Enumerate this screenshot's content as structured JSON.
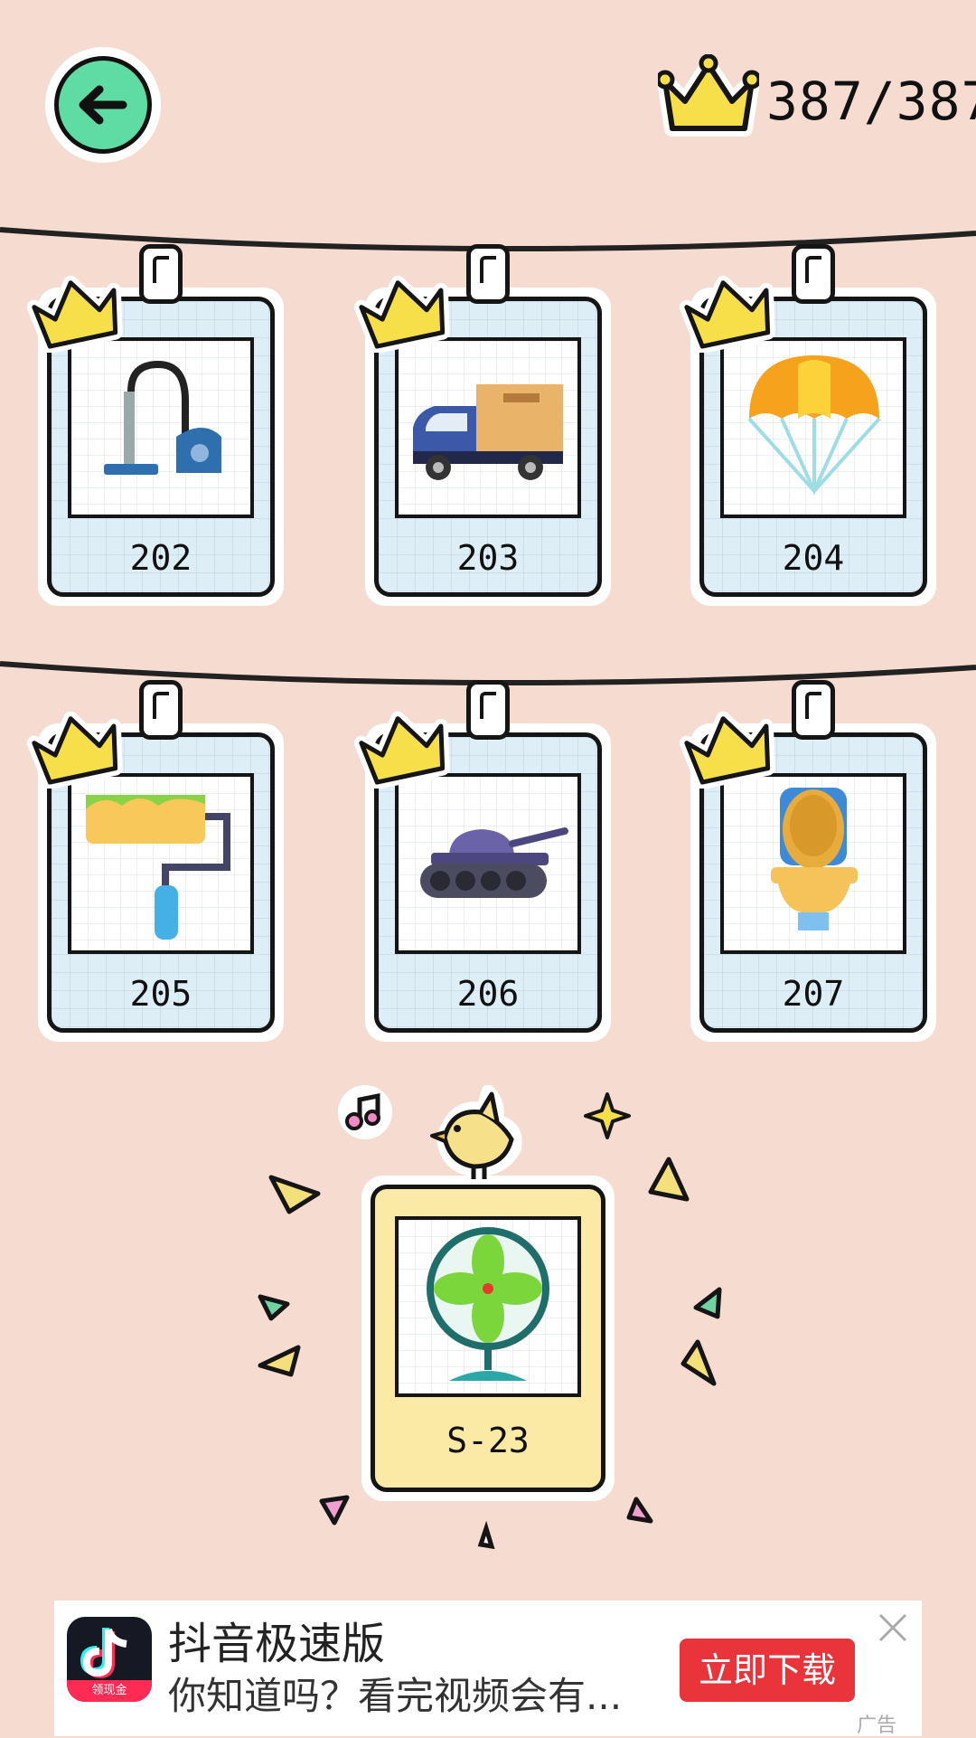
{
  "header": {
    "back_icon": "arrow-left-icon",
    "crown_icon": "crown-icon",
    "progress_text": "387/387"
  },
  "cards": [
    {
      "label": "202",
      "icon": "vacuum-cleaner-icon",
      "completed": true
    },
    {
      "label": "203",
      "icon": "truck-icon",
      "completed": true
    },
    {
      "label": "204",
      "icon": "parachute-icon",
      "completed": true
    },
    {
      "label": "205",
      "icon": "paint-roller-icon",
      "completed": true
    },
    {
      "label": "206",
      "icon": "tank-icon",
      "completed": true
    },
    {
      "label": "207",
      "icon": "toilet-icon",
      "completed": true
    }
  ],
  "featured": {
    "label": "S-23",
    "icon": "electric-fan-icon",
    "decoration_icons": [
      "bird-icon",
      "music-note-icon",
      "sparkle-icon"
    ]
  },
  "ad": {
    "title": "抖音极速版",
    "description": "你知道吗？看完视频会有...",
    "button_label": "立即下载",
    "logo_badge": "领现金",
    "tag": "广告",
    "close_icon": "close-icon"
  },
  "colors": {
    "background": "#f5dbd0",
    "card_blue": "#ddeef7",
    "card_yellow": "#fbeaa5",
    "crown": "#f7df4a",
    "back_button": "#5fdba4",
    "ad_button": "#e8343a"
  }
}
